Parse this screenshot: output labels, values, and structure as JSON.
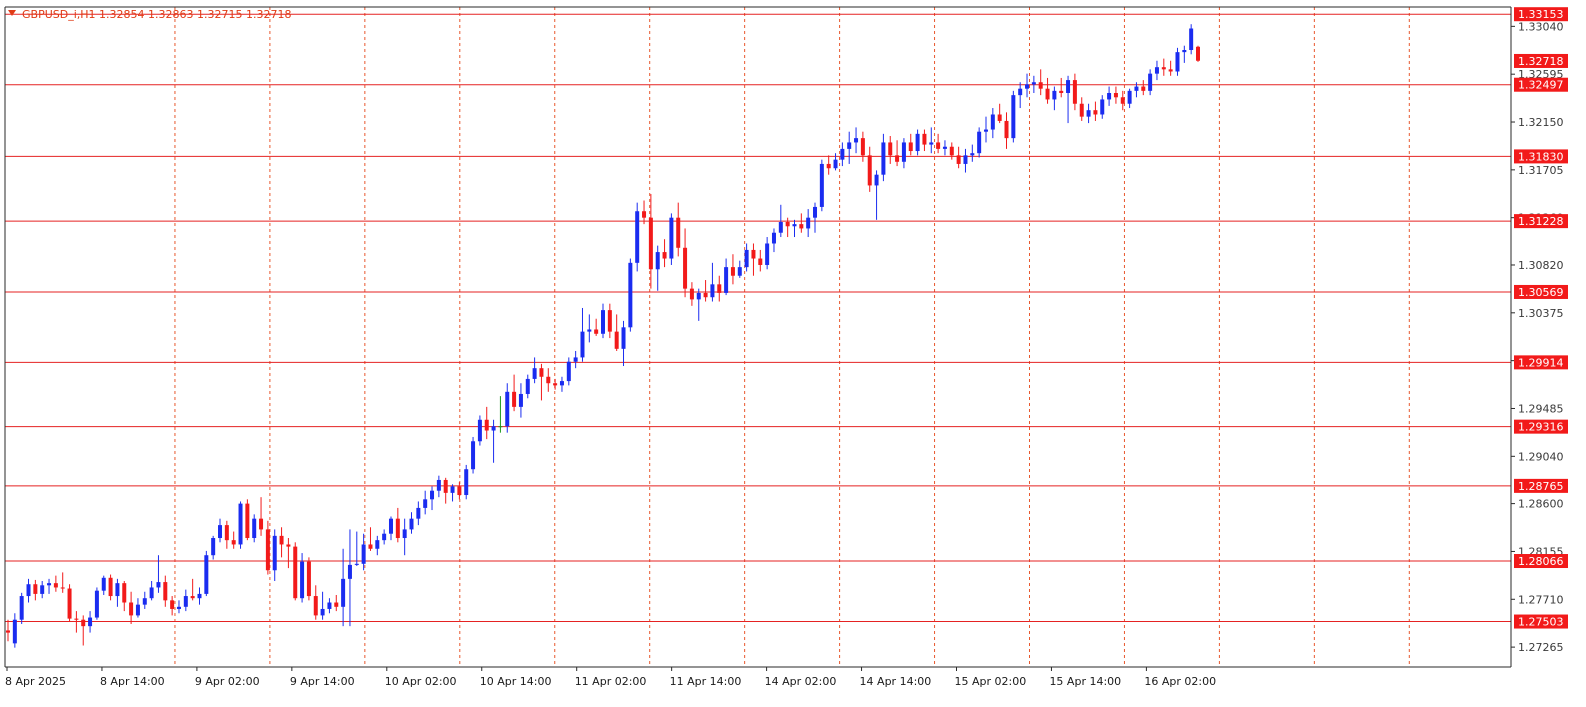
{
  "header": {
    "symbol_line": "GBPUSD_i,H1  1.32854 1.32863 1.32715 1.32718"
  },
  "colors": {
    "bull": "#1a2cf0",
    "bear": "#f21a1a",
    "doji": "#1a9a1a",
    "level_line": "#e52222",
    "grid": "#e8582e",
    "tag_bg": "#f21a1a",
    "axis": "#2a2a2a",
    "header": "#e03a14"
  },
  "chart_data": {
    "type": "candlestick",
    "symbol": "GBPUSD_i",
    "timeframe": "H1",
    "ylim": [
      1.2708,
      1.3322
    ],
    "grid": true,
    "price_ticks": [
      "1.33040",
      "1.32595",
      "1.32150",
      "1.31705",
      "1.31260",
      "1.30820",
      "1.30375",
      "1.29930",
      "1.29485",
      "1.29040",
      "1.28600",
      "1.28155",
      "1.27710",
      "1.27265"
    ],
    "time_labels": [
      "8 Apr 2025",
      "8 Apr 14:00",
      "9 Apr 02:00",
      "9 Apr 14:00",
      "10 Apr 02:00",
      "10 Apr 14:00",
      "11 Apr 02:00",
      "11 Apr 14:00",
      "14 Apr 02:00",
      "14 Apr 14:00",
      "15 Apr 02:00",
      "15 Apr 14:00",
      "16 Apr 02:00"
    ],
    "levels": [
      "1.33153",
      "1.32718",
      "1.32497",
      "1.31830",
      "1.31228",
      "1.30569",
      "1.29914",
      "1.29316",
      "1.28765",
      "1.28066",
      "1.27503"
    ],
    "current_price": "1.32718",
    "candles": [
      [
        1.2742,
        1.2752,
        1.2732,
        1.274
      ],
      [
        1.273,
        1.2758,
        1.2726,
        1.2752
      ],
      [
        1.2752,
        1.2777,
        1.2748,
        1.2774
      ],
      [
        1.2774,
        1.279,
        1.2768,
        1.2785
      ],
      [
        1.2785,
        1.2789,
        1.277,
        1.2776
      ],
      [
        1.2776,
        1.2788,
        1.2772,
        1.2784
      ],
      [
        1.2784,
        1.279,
        1.2776,
        1.2786
      ],
      [
        1.2786,
        1.2793,
        1.2778,
        1.2782
      ],
      [
        1.2782,
        1.2796,
        1.2777,
        1.2781
      ],
      [
        1.2781,
        1.2785,
        1.275,
        1.2753
      ],
      [
        1.2753,
        1.276,
        1.274,
        1.2752
      ],
      [
        1.2752,
        1.2756,
        1.2728,
        1.2746
      ],
      [
        1.2746,
        1.276,
        1.274,
        1.2754
      ],
      [
        1.2754,
        1.2782,
        1.2752,
        1.2779
      ],
      [
        1.2779,
        1.2793,
        1.2775,
        1.2791
      ],
      [
        1.2791,
        1.2794,
        1.277,
        1.2774
      ],
      [
        1.2774,
        1.279,
        1.2764,
        1.2786
      ],
      [
        1.2786,
        1.2788,
        1.276,
        1.2768
      ],
      [
        1.2768,
        1.2778,
        1.2748,
        1.2756
      ],
      [
        1.2756,
        1.2772,
        1.2754,
        1.2766
      ],
      [
        1.2766,
        1.2778,
        1.2762,
        1.2772
      ],
      [
        1.2772,
        1.2788,
        1.277,
        1.2782
      ],
      [
        1.2782,
        1.2812,
        1.2777,
        1.2787
      ],
      [
        1.2787,
        1.2793,
        1.2764,
        1.277
      ],
      [
        1.277,
        1.2774,
        1.2756,
        1.2762
      ],
      [
        1.2762,
        1.277,
        1.2758,
        1.2764
      ],
      [
        1.2764,
        1.278,
        1.276,
        1.2774
      ],
      [
        1.2774,
        1.279,
        1.277,
        1.2772
      ],
      [
        1.2772,
        1.2782,
        1.2766,
        1.2776
      ],
      [
        1.2776,
        1.2816,
        1.2774,
        1.2812
      ],
      [
        1.2812,
        1.283,
        1.2808,
        1.2828
      ],
      [
        1.2828,
        1.2846,
        1.2824,
        1.284
      ],
      [
        1.284,
        1.2844,
        1.2818,
        1.2826
      ],
      [
        1.2826,
        1.2834,
        1.2818,
        1.2822
      ],
      [
        1.2822,
        1.2862,
        1.2818,
        1.286
      ],
      [
        1.286,
        1.2864,
        1.2826,
        1.2828
      ],
      [
        1.2828,
        1.285,
        1.2824,
        1.2846
      ],
      [
        1.2846,
        1.2866,
        1.283,
        1.2836
      ],
      [
        1.2836,
        1.2844,
        1.2794,
        1.2798
      ],
      [
        1.2798,
        1.2836,
        1.2788,
        1.283
      ],
      [
        1.283,
        1.2838,
        1.281,
        1.2822
      ],
      [
        1.2822,
        1.2828,
        1.28,
        1.282
      ],
      [
        1.282,
        1.2824,
        1.277,
        1.2772
      ],
      [
        1.2772,
        1.2814,
        1.2768,
        1.2806
      ],
      [
        1.2806,
        1.281,
        1.277,
        1.2774
      ],
      [
        1.2774,
        1.2784,
        1.2752,
        1.2756
      ],
      [
        1.2756,
        1.2778,
        1.2752,
        1.2762
      ],
      [
        1.2762,
        1.2772,
        1.2758,
        1.2768
      ],
      [
        1.2768,
        1.2775,
        1.276,
        1.2764
      ],
      [
        1.2764,
        1.2818,
        1.2746,
        1.279
      ],
      [
        1.279,
        1.2836,
        1.2746,
        1.2803
      ],
      [
        1.2803,
        1.2834,
        1.2802,
        1.2804
      ],
      [
        1.2804,
        1.2832,
        1.2798,
        1.2822
      ],
      [
        1.2822,
        1.2838,
        1.2816,
        1.2818
      ],
      [
        1.2818,
        1.283,
        1.2812,
        1.2826
      ],
      [
        1.2826,
        1.2836,
        1.2822,
        1.2832
      ],
      [
        1.2832,
        1.2848,
        1.2826,
        1.2846
      ],
      [
        1.2846,
        1.2856,
        1.2824,
        1.2828
      ],
      [
        1.2828,
        1.2846,
        1.2812,
        1.2836
      ],
      [
        1.2836,
        1.2852,
        1.2832,
        1.2846
      ],
      [
        1.2846,
        1.2862,
        1.284,
        1.2856
      ],
      [
        1.2856,
        1.2872,
        1.285,
        1.2864
      ],
      [
        1.2864,
        1.2876,
        1.2854,
        1.2872
      ],
      [
        1.2872,
        1.2886,
        1.2866,
        1.2882
      ],
      [
        1.2882,
        1.2884,
        1.286,
        1.287
      ],
      [
        1.287,
        1.2878,
        1.2862,
        1.2876
      ],
      [
        1.2876,
        1.288,
        1.2864,
        1.2868
      ],
      [
        1.2868,
        1.2896,
        1.2864,
        1.2892
      ],
      [
        1.2892,
        1.2922,
        1.2888,
        1.2918
      ],
      [
        1.2918,
        1.2942,
        1.2914,
        1.2938
      ],
      [
        1.2938,
        1.295,
        1.292,
        1.2928
      ],
      [
        1.2928,
        1.2938,
        1.2898,
        1.2932
      ],
      [
        1.2932,
        1.296,
        1.2926,
        1.2932
      ],
      [
        1.2932,
        1.2972,
        1.2926,
        1.2964
      ],
      [
        1.2964,
        1.298,
        1.2946,
        1.295
      ],
      [
        1.295,
        1.2972,
        1.294,
        1.2962
      ],
      [
        1.2962,
        1.298,
        1.2958,
        1.2976
      ],
      [
        1.2976,
        1.2996,
        1.2972,
        1.2986
      ],
      [
        1.2986,
        1.299,
        1.2956,
        1.2978
      ],
      [
        1.2978,
        1.2986,
        1.2964,
        1.2972
      ],
      [
        1.2972,
        1.2976,
        1.2966,
        1.297
      ],
      [
        1.297,
        1.2978,
        1.2964,
        1.2974
      ],
      [
        1.2974,
        1.2996,
        1.297,
        1.2992
      ],
      [
        1.2992,
        1.3002,
        1.2986,
        1.2996
      ],
      [
        1.2996,
        1.3042,
        1.2992,
        1.302
      ],
      [
        1.302,
        1.3036,
        1.301,
        1.3022
      ],
      [
        1.3022,
        1.3032,
        1.3016,
        1.3018
      ],
      [
        1.3018,
        1.3046,
        1.3014,
        1.304
      ],
      [
        1.304,
        1.3046,
        1.3014,
        1.302
      ],
      [
        1.302,
        1.3036,
        1.3002,
        1.3004
      ],
      [
        1.3004,
        1.303,
        1.2988,
        1.3024
      ],
      [
        1.3024,
        1.3088,
        1.302,
        1.3084
      ],
      [
        1.3084,
        1.314,
        1.3076,
        1.3132
      ],
      [
        1.3132,
        1.3142,
        1.312,
        1.3126
      ],
      [
        1.3126,
        1.3148,
        1.306,
        1.3078
      ],
      [
        1.3078,
        1.31,
        1.3058,
        1.3094
      ],
      [
        1.3094,
        1.3106,
        1.308,
        1.3088
      ],
      [
        1.3088,
        1.313,
        1.3082,
        1.3126
      ],
      [
        1.3126,
        1.314,
        1.309,
        1.3098
      ],
      [
        1.3098,
        1.3116,
        1.3052,
        1.306
      ],
      [
        1.306,
        1.3066,
        1.3044,
        1.305
      ],
      [
        1.305,
        1.306,
        1.303,
        1.3056
      ],
      [
        1.3056,
        1.3068,
        1.3048,
        1.3052
      ],
      [
        1.3052,
        1.3084,
        1.3048,
        1.3064
      ],
      [
        1.3064,
        1.3072,
        1.3048,
        1.3056
      ],
      [
        1.3056,
        1.3088,
        1.3054,
        1.308
      ],
      [
        1.308,
        1.3092,
        1.3064,
        1.3072
      ],
      [
        1.3072,
        1.3086,
        1.307,
        1.308
      ],
      [
        1.308,
        1.3102,
        1.3076,
        1.3096
      ],
      [
        1.3096,
        1.3102,
        1.3072,
        1.3088
      ],
      [
        1.3088,
        1.3096,
        1.3076,
        1.3082
      ],
      [
        1.3082,
        1.3108,
        1.3078,
        1.3102
      ],
      [
        1.3102,
        1.3116,
        1.3094,
        1.3112
      ],
      [
        1.3112,
        1.3138,
        1.3108,
        1.3122
      ],
      [
        1.3122,
        1.3126,
        1.3108,
        1.3118
      ],
      [
        1.3118,
        1.3124,
        1.3108,
        1.312
      ],
      [
        1.312,
        1.313,
        1.3112,
        1.3116
      ],
      [
        1.3116,
        1.3134,
        1.3108,
        1.3126
      ],
      [
        1.3126,
        1.314,
        1.3112,
        1.3136
      ],
      [
        1.3136,
        1.318,
        1.3132,
        1.3176
      ],
      [
        1.3176,
        1.3184,
        1.3166,
        1.3172
      ],
      [
        1.3172,
        1.3186,
        1.317,
        1.318
      ],
      [
        1.318,
        1.3196,
        1.3174,
        1.319
      ],
      [
        1.319,
        1.3206,
        1.3176,
        1.3196
      ],
      [
        1.3196,
        1.321,
        1.3186,
        1.32
      ],
      [
        1.32,
        1.3206,
        1.3178,
        1.3184
      ],
      [
        1.3184,
        1.3192,
        1.315,
        1.3156
      ],
      [
        1.3156,
        1.317,
        1.3124,
        1.3166
      ],
      [
        1.3166,
        1.3204,
        1.316,
        1.3196
      ],
      [
        1.3196,
        1.3202,
        1.3176,
        1.3184
      ],
      [
        1.3184,
        1.3198,
        1.3174,
        1.3178
      ],
      [
        1.3178,
        1.32,
        1.3172,
        1.3196
      ],
      [
        1.3196,
        1.3204,
        1.3184,
        1.3188
      ],
      [
        1.3188,
        1.3208,
        1.3184,
        1.3204
      ],
      [
        1.3204,
        1.3208,
        1.3188,
        1.3194
      ],
      [
        1.3194,
        1.321,
        1.3186,
        1.3196
      ],
      [
        1.3196,
        1.3204,
        1.3186,
        1.319
      ],
      [
        1.319,
        1.3198,
        1.3184,
        1.3192
      ],
      [
        1.3192,
        1.3196,
        1.318,
        1.3184
      ],
      [
        1.3184,
        1.3192,
        1.3172,
        1.3176
      ],
      [
        1.3176,
        1.319,
        1.3168,
        1.3184
      ],
      [
        1.3184,
        1.3194,
        1.3178,
        1.3186
      ],
      [
        1.3186,
        1.321,
        1.3182,
        1.3206
      ],
      [
        1.3206,
        1.322,
        1.3196,
        1.3208
      ],
      [
        1.3208,
        1.3228,
        1.32,
        1.3222
      ],
      [
        1.3222,
        1.3232,
        1.3214,
        1.3216
      ],
      [
        1.3216,
        1.3224,
        1.319,
        1.32
      ],
      [
        1.32,
        1.3244,
        1.3196,
        1.324
      ],
      [
        1.324,
        1.3252,
        1.3228,
        1.3246
      ],
      [
        1.3246,
        1.326,
        1.3238,
        1.325
      ],
      [
        1.325,
        1.3258,
        1.3242,
        1.3252
      ],
      [
        1.3252,
        1.3264,
        1.324,
        1.3246
      ],
      [
        1.3246,
        1.3256,
        1.3232,
        1.3236
      ],
      [
        1.3236,
        1.3248,
        1.3226,
        1.3244
      ],
      [
        1.3244,
        1.3256,
        1.3238,
        1.3242
      ],
      [
        1.3242,
        1.3258,
        1.3214,
        1.3254
      ],
      [
        1.3254,
        1.326,
        1.3226,
        1.3232
      ],
      [
        1.3232,
        1.3238,
        1.3216,
        1.322
      ],
      [
        1.322,
        1.3232,
        1.3214,
        1.3226
      ],
      [
        1.3226,
        1.3234,
        1.3216,
        1.3222
      ],
      [
        1.3222,
        1.324,
        1.3218,
        1.3236
      ],
      [
        1.3236,
        1.3248,
        1.323,
        1.3242
      ],
      [
        1.3242,
        1.3248,
        1.3232,
        1.3238
      ],
      [
        1.3238,
        1.3244,
        1.3226,
        1.3232
      ],
      [
        1.3232,
        1.3246,
        1.3228,
        1.3244
      ],
      [
        1.3244,
        1.3252,
        1.3238,
        1.3248
      ],
      [
        1.3248,
        1.3254,
        1.324,
        1.3244
      ],
      [
        1.3244,
        1.3264,
        1.324,
        1.326
      ],
      [
        1.326,
        1.3272,
        1.3254,
        1.3266
      ],
      [
        1.3266,
        1.3274,
        1.3258,
        1.3264
      ],
      [
        1.3264,
        1.3272,
        1.3258,
        1.3262
      ],
      [
        1.3262,
        1.3284,
        1.3258,
        1.328
      ],
      [
        1.328,
        1.3286,
        1.327,
        1.3282
      ],
      [
        1.3282,
        1.3306,
        1.3278,
        1.3302
      ],
      [
        1.3285,
        1.3286,
        1.3271,
        1.3272
      ]
    ]
  }
}
